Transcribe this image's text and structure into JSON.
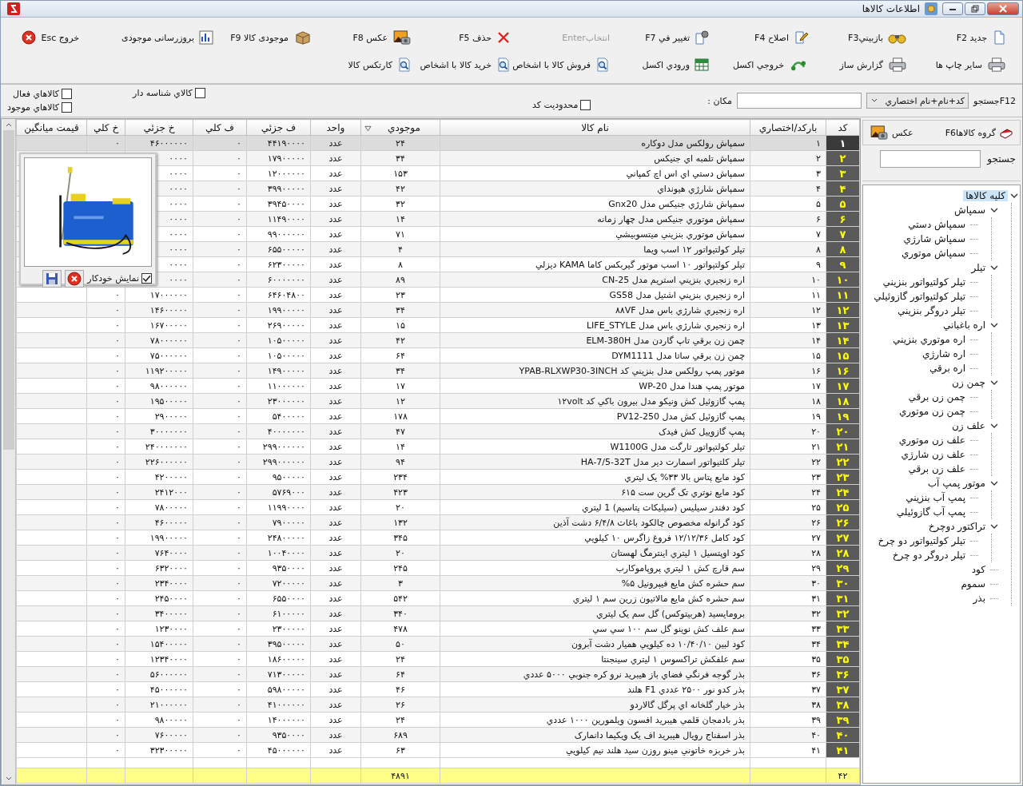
{
  "window": {
    "title": "اطلاعات کالاها"
  },
  "toolbar": {
    "row_1": [
      {
        "label": "جديد F2",
        "disabled": false
      },
      {
        "label": "بازبينيF3",
        "disabled": false
      },
      {
        "label": "اصلاح F4",
        "disabled": false
      },
      {
        "label": "تغيير في F7",
        "disabled": false
      },
      {
        "label": "انتخابEnter",
        "disabled": true
      },
      {
        "label": "حذف F5",
        "disabled": false
      },
      {
        "label": "عکس F8",
        "disabled": false
      },
      {
        "label": "موجودی کالا F9",
        "disabled": false
      },
      {
        "label": "بروزرسانی موجودی",
        "disabled": false
      }
    ],
    "row_2": [
      {
        "label": "ساير چاپ ها",
        "disabled": false
      },
      {
        "label": "گزارش ساز",
        "disabled": false
      },
      {
        "label": "خروجي اکسل",
        "disabled": false
      },
      {
        "label": "ورودي اکسل",
        "disabled": false
      },
      {
        "label": "فروش کالا با اشخاص",
        "disabled": false
      },
      {
        "label": "خريد کالا با اشخاص",
        "disabled": false
      },
      {
        "label": "کارتکس کالا",
        "disabled": false
      }
    ],
    "exit": {
      "label": "خروج  Esc"
    }
  },
  "filter": {
    "search_label": "F12جستجو",
    "search_mode": "کد+نام+نام اختصاري",
    "place_label": "مکان :",
    "checkboxes": [
      {
        "label": "محدوديت کد",
        "checked": false
      },
      {
        "label": "کالاي شناسه دار",
        "checked": false
      },
      {
        "label": "کالاهاي فعال",
        "checked": false
      },
      {
        "label": "کالاهاي موجود",
        "checked": false
      }
    ]
  },
  "table": {
    "columns": [
      {
        "label": "کد",
        "sorted": false
      },
      {
        "label": "بارکد/اختصاري",
        "sorted": false
      },
      {
        "label": "نام کالا",
        "sorted": false
      },
      {
        "label": "موجودي",
        "sorted": true
      },
      {
        "label": "واحد",
        "sorted": false
      },
      {
        "label": "ف جزئي",
        "sorted": false
      },
      {
        "label": "ف کلي",
        "sorted": false
      },
      {
        "label": "خ جزئي",
        "sorted": false
      },
      {
        "label": "خ کلي",
        "sorted": false
      },
      {
        "label": "قيمت ميانگين",
        "sorted": false
      }
    ],
    "rows": [
      {
        "code": "۱",
        "barcode": "۱",
        "name": "سمپاش رولکس مدل دوکاره",
        "stock": "۲۴",
        "unit": "عدد",
        "sale_unit": "۴۴۱۹۰۰۰۰",
        "sale_total": "۰",
        "buy_unit": "۴۶۰۰۰۰۰۰",
        "buy_total": "۰",
        "selected": true
      },
      {
        "code": "۲",
        "barcode": "۲",
        "name": "سمپاش تلمبه اي جنيکس",
        "stock": "۳۴",
        "unit": "عدد",
        "sale_unit": "۱۷۹۰۰۰۰۰",
        "sale_total": "۰",
        "buy_unit": "۰۰۰۰",
        "selected": false
      },
      {
        "code": "۳",
        "barcode": "۳",
        "name": "سمپاش دستي اي اس اچ کمپاني",
        "stock": "۱۵۳",
        "unit": "عدد",
        "sale_unit": "۱۲۰۰۰۰۰۰",
        "sale_total": "۰",
        "buy_unit": "۰۰۰۰",
        "selected": false
      },
      {
        "code": "۴",
        "barcode": "۴",
        "name": "سمپاش شارژي هيونداي",
        "stock": "۴۲",
        "unit": "عدد",
        "sale_unit": "۳۹۹۰۰۰۰۰",
        "sale_total": "۰",
        "buy_unit": "۰۰۰۰",
        "selected": false
      },
      {
        "code": "۵",
        "barcode": "۵",
        "name": "سمپاش شارژي جنيکس مدل Gnx20",
        "stock": "۳۲",
        "unit": "عدد",
        "sale_unit": "۳۹۴۵۰۰۰۰",
        "sale_total": "۰",
        "buy_unit": "۰۰۰۰",
        "selected": false
      },
      {
        "code": "۶",
        "barcode": "۶",
        "name": "سمپاش موتوري جنيکس مدل چهار زمانه",
        "stock": "۱۴",
        "unit": "عدد",
        "sale_unit": "۱۱۴۹۰۰۰۰",
        "sale_total": "۰",
        "buy_unit": "۰۰۰۰",
        "selected": false
      },
      {
        "code": "۷",
        "barcode": "۷",
        "name": "سمپاش موتوري بنزيني ميتسوبيشي",
        "stock": "۷۱",
        "unit": "عدد",
        "sale_unit": "۹۹۰۰۰۰۰۰",
        "sale_total": "۰",
        "buy_unit": "۰۰۰۰",
        "selected": false
      },
      {
        "code": "۸",
        "barcode": "۸",
        "name": "تيلر کولتيواتور ۱۲ اسب ويما",
        "stock": "۴",
        "unit": "عدد",
        "sale_unit": "۶۵۵۰۰۰۰۰",
        "sale_total": "۰",
        "buy_unit": "۰۰۰۰",
        "selected": false
      },
      {
        "code": "۹",
        "barcode": "۹",
        "name": "تيلر کولتيواتور ۱۰ اسب موتور گيربکس کاما KAMA ديزلي",
        "stock": "۸",
        "unit": "عدد",
        "sale_unit": "۶۲۳۰۰۰۰۰",
        "sale_total": "۰",
        "buy_unit": "۰۰۰۰",
        "selected": false
      },
      {
        "code": "۱۰",
        "barcode": "۱۰",
        "name": "اره زنجيري بنزيني استريم مدل CN-25",
        "stock": "۸۹",
        "unit": "عدد",
        "sale_unit": "۶۰۰۰۰۰۰۰",
        "sale_total": "۰",
        "buy_unit": "۰۰۰۰",
        "selected": false
      },
      {
        "code": "۱۱",
        "barcode": "۱۱",
        "name": "اره زنجيري بنزيني اشتيل مدل GS58",
        "stock": "۲۳",
        "unit": "عدد",
        "sale_unit": "۶۴۶۰۴۸۰۰",
        "sale_total": "۰",
        "buy_unit": "۱۷۰۰۰۰۰۰",
        "buy_total": "۰",
        "selected": false
      },
      {
        "code": "۱۲",
        "barcode": "۱۲",
        "name": "اره زنجيري شارژي باس مدل ۸۸VF",
        "stock": "۳۴",
        "unit": "عدد",
        "sale_unit": "۱۹۹۰۰۰۰۰",
        "sale_total": "۰",
        "buy_unit": "۱۴۶۰۰۰۰۰",
        "buy_total": "۰",
        "selected": false
      },
      {
        "code": "۱۳",
        "barcode": "۱۳",
        "name": "اره زنجيري شارژي باس مدل LIFE_STYLE",
        "stock": "۱۵",
        "unit": "عدد",
        "sale_unit": "۲۶۹۰۰۰۰۰",
        "sale_total": "۰",
        "buy_unit": "۱۶۷۰۰۰۰۰",
        "buy_total": "۰",
        "selected": false
      },
      {
        "code": "۱۴",
        "barcode": "۱۴",
        "name": "چمن زن برقي تاپ گاردن مدل ELM-380H",
        "stock": "۴۲",
        "unit": "عدد",
        "sale_unit": "۱۰۵۰۰۰۰۰",
        "sale_total": "۰",
        "buy_unit": "۷۸۰۰۰۰۰۰",
        "buy_total": "۰",
        "selected": false
      },
      {
        "code": "۱۵",
        "barcode": "۱۵",
        "name": "چمن زن برقي ساتا مدل DYM1111",
        "stock": "۶۴",
        "unit": "عدد",
        "sale_unit": "۱۰۵۰۰۰۰۰",
        "sale_total": "۰",
        "buy_unit": "۷۵۰۰۰۰۰۰",
        "buy_total": "۰",
        "selected": false
      },
      {
        "code": "۱۶",
        "barcode": "۱۶",
        "name": "موتور پمپ رولکس مدل بنزيني کد YPAB-RLXWP30-3INCH",
        "stock": "۳۴",
        "unit": "عدد",
        "sale_unit": "۱۴۹۰۰۰۰۰",
        "sale_total": "۰",
        "buy_unit": "۱۱۹۲۰۰۰۰۰",
        "buy_total": "۰",
        "selected": false
      },
      {
        "code": "۱۷",
        "barcode": "۱۷",
        "name": "موتور پمپ هندا مدل WP-20",
        "stock": "۱۷",
        "unit": "عدد",
        "sale_unit": "۱۱۰۰۰۰۰۰",
        "sale_total": "۰",
        "buy_unit": "۹۸۰۰۰۰۰۰",
        "buy_total": "۰",
        "selected": false
      },
      {
        "code": "۱۸",
        "barcode": "۱۸",
        "name": "پمپ گازوئيل کش ونيکو مدل بيرون باکي کد ۱۲volt",
        "stock": "۱۲",
        "unit": "عدد",
        "sale_unit": "۲۳۰۰۰۰۰۰",
        "sale_total": "۰",
        "buy_unit": "۱۹۵۰۰۰۰۰",
        "buy_total": "۰",
        "selected": false
      },
      {
        "code": "۱۹",
        "barcode": "۱۹",
        "name": "پمپ گازوئيل کش مدل PV12-250",
        "stock": "۱۷۸",
        "unit": "عدد",
        "sale_unit": "۵۴۰۰۰۰۰",
        "sale_total": "۰",
        "buy_unit": "۲۹۰۰۰۰۰",
        "buy_total": "۰",
        "selected": false
      },
      {
        "code": "۲۰",
        "barcode": "۲۰",
        "name": "پمپ گازوييل کش فيدک",
        "stock": "۴۷",
        "unit": "عدد",
        "sale_unit": "۴۰۰۰۰۰۰۰",
        "sale_total": "۰",
        "buy_unit": "۳۰۰۰۰۰۰۰",
        "buy_total": "۰",
        "selected": false
      },
      {
        "code": "۲۱",
        "barcode": "۲۱",
        "name": "تيلر کولتيواتور تارگت مدل W1100G",
        "stock": "۱۴",
        "unit": "عدد",
        "sale_unit": "۲۹۹۰۰۰۰۰۰",
        "sale_total": "۰",
        "buy_unit": "۲۴۰۰۰۰۰۰۰",
        "buy_total": "۰",
        "selected": false
      },
      {
        "code": "۲۲",
        "barcode": "۲۲",
        "name": "تيلر کلتيواتور اسمارت دير مدل HA-7/5-32T",
        "stock": "۹۴",
        "unit": "عدد",
        "sale_unit": "۲۹۹۰۰۰۰۰۰",
        "sale_total": "۰",
        "buy_unit": "۲۲۶۰۰۰۰۰۰",
        "buy_total": "۰",
        "selected": false
      },
      {
        "code": "۲۳",
        "barcode": "۲۳",
        "name": "کود مايع پتاس بالا ۳۳% يک ليتري",
        "stock": "۲۳۴",
        "unit": "عدد",
        "sale_unit": "۹۵۰۰۰۰۰",
        "sale_total": "۰",
        "buy_unit": "۴۲۰۰۰۰۰",
        "buy_total": "۰",
        "selected": false
      },
      {
        "code": "۲۴",
        "barcode": "۲۴",
        "name": "کود مايع نوتري تک گرين ست ۶۱۵",
        "stock": "۴۲۳",
        "unit": "عدد",
        "sale_unit": "۵۷۶۹۰۰۰",
        "sale_total": "۰",
        "buy_unit": "۲۴۱۲۰۰۰",
        "buy_total": "۰",
        "selected": false
      },
      {
        "code": "۲۵",
        "barcode": "۲۵",
        "name": "کود دفندر سيليس (سيليکات پتاسيم) 1 ليتري",
        "stock": "۲۰",
        "unit": "عدد",
        "sale_unit": "۱۱۹۹۰۰۰۰",
        "sale_total": "۰",
        "buy_unit": "۷۸۰۰۰۰۰",
        "buy_total": "۰",
        "selected": false
      },
      {
        "code": "۲۶",
        "barcode": "۲۶",
        "name": "کود گرانوله مخصوص چالکود باغات ۶/۴/۸ دشت آذين",
        "stock": "۱۳۲",
        "unit": "عدد",
        "sale_unit": "۷۹۰۰۰۰۰",
        "sale_total": "۰",
        "buy_unit": "۴۶۰۰۰۰۰",
        "buy_total": "۰",
        "selected": false
      },
      {
        "code": "۲۷",
        "barcode": "۲۷",
        "name": "کود کامل ۱۲/۱۲/۳۶ فروغ زاگرس ۱۰ کيلويي",
        "stock": "۳۴۵",
        "unit": "عدد",
        "sale_unit": "۲۴۸۰۰۰۰۰",
        "sale_total": "۰",
        "buy_unit": "۱۹۹۰۰۰۰۰",
        "buy_total": "۰",
        "selected": false
      },
      {
        "code": "۲۸",
        "barcode": "۲۸",
        "name": "کود اوپتسيل ۱ ليتري اينترمگ لهستان",
        "stock": "۲۰",
        "unit": "عدد",
        "sale_unit": "۱۰۰۴۰۰۰۰",
        "sale_total": "۰",
        "buy_unit": "۷۶۴۰۰۰۰",
        "buy_total": "۰",
        "selected": false
      },
      {
        "code": "۲۹",
        "barcode": "۲۹",
        "name": "سم قارچ کش ۱ ليتري پروپاموکارب",
        "stock": "۲۴۵",
        "unit": "عدد",
        "sale_unit": "۹۳۵۰۰۰۰",
        "sale_total": "۰",
        "buy_unit": "۶۳۲۰۰۰۰",
        "buy_total": "۰",
        "selected": false
      },
      {
        "code": "۳۰",
        "barcode": "۳۰",
        "name": "سم حشره کش مايع فيپرونيل ۵%",
        "stock": "۳",
        "unit": "عدد",
        "sale_unit": "۷۲۰۰۰۰۰",
        "sale_total": "۰",
        "buy_unit": "۲۳۴۰۰۰۰",
        "buy_total": "۰",
        "selected": false
      },
      {
        "code": "۳۱",
        "barcode": "۳۱",
        "name": "سم حشره کش مايع مالاتيون زرين سم ۱ ليتري",
        "stock": "۵۴۲",
        "unit": "عدد",
        "sale_unit": "۶۵۵۰۰۰۰",
        "sale_total": "۰",
        "buy_unit": "۲۴۵۰۰۰۰",
        "buy_total": "۰",
        "selected": false
      },
      {
        "code": "۳۲",
        "barcode": "۳۲",
        "name": "برومايسيد (هربيتوکس) گل سم يک ليتري",
        "stock": "۳۴۰",
        "unit": "عدد",
        "sale_unit": "۶۱۰۰۰۰۰",
        "sale_total": "۰",
        "buy_unit": "۳۴۰۰۰۰۰",
        "buy_total": "۰",
        "selected": false
      },
      {
        "code": "۳۳",
        "barcode": "۳۳",
        "name": "سم علف کش نوينو گل سم ۱۰۰ سي سي",
        "stock": "۴۷۸",
        "unit": "عدد",
        "sale_unit": "۲۳۰۰۰۰۰",
        "sale_total": "۰",
        "buy_unit": "۱۲۳۰۰۰۰",
        "buy_total": "۰",
        "selected": false
      },
      {
        "code": "۳۴",
        "barcode": "۳۴",
        "name": "کود لبين ۱۰/۴۰/۱۰ ده کيلويي هميار دشت آبرون",
        "stock": "۵۰",
        "unit": "عدد",
        "sale_unit": "۳۹۵۰۰۰۰۰",
        "sale_total": "۰",
        "buy_unit": "۱۵۴۰۰۰۰۰",
        "buy_total": "۰",
        "selected": false
      },
      {
        "code": "۳۵",
        "barcode": "۳۵",
        "name": "سم علفکش تراکسوس ۱ ليتري سينجنتا",
        "stock": "۲۴",
        "unit": "عدد",
        "sale_unit": "۱۸۶۰۰۰۰۰",
        "sale_total": "۰",
        "buy_unit": "۱۲۳۴۰۰۰۰",
        "buy_total": "۰",
        "selected": false
      },
      {
        "code": "۳۶",
        "barcode": "۳۶",
        "name": "بذر گوجه فرنگي فضاي باز هيبريد نرو کره جنوبي ۵۰۰۰ عددي",
        "stock": "۶۴",
        "unit": "عدد",
        "sale_unit": "۷۱۳۰۰۰۰۰",
        "sale_total": "۰",
        "buy_unit": "۵۶۰۰۰۰۰۰",
        "buy_total": "۰",
        "selected": false
      },
      {
        "code": "۳۷",
        "barcode": "۳۷",
        "name": "بذر کدو نور ۲۵۰۰ عددي F1 هلند",
        "stock": "۴۶",
        "unit": "عدد",
        "sale_unit": "۵۹۸۰۰۰۰۰",
        "sale_total": "۰",
        "buy_unit": "۴۵۰۰۰۰۰۰",
        "buy_total": "۰",
        "selected": false
      },
      {
        "code": "۳۸",
        "barcode": "۳۸",
        "name": "بذر خيار گلخانه اي پرگل گالاردو",
        "stock": "۲۶",
        "unit": "عدد",
        "sale_unit": "۴۱۰۰۰۰۰۰",
        "sale_total": "۰",
        "buy_unit": "۲۱۰۰۰۰۰۰",
        "buy_total": "۰",
        "selected": false
      },
      {
        "code": "۳۹",
        "barcode": "۳۹",
        "name": "بذر بادمجان قلمي هيبريد افسون ويلمورين ۱۰۰۰ عددي",
        "stock": "۲۴",
        "unit": "عدد",
        "sale_unit": "۱۴۰۰۰۰۰۰",
        "sale_total": "۰",
        "buy_unit": "۹۸۰۰۰۰۰",
        "buy_total": "۰",
        "selected": false
      },
      {
        "code": "۴۰",
        "barcode": "۴۰",
        "name": "بذر اسفناج رويال هيبريد اف يک ويکيما دانمارک",
        "stock": "۶۸۹",
        "unit": "عدد",
        "sale_unit": "۹۳۵۰۰۰۰",
        "sale_total": "۰",
        "buy_unit": "۷۶۰۰۰۰۰",
        "buy_total": "۰",
        "selected": false
      },
      {
        "code": "۴۱",
        "barcode": "۴۱",
        "name": "بذر خربزه خاتوني مينو روزن سيد هلند نيم کيلويي",
        "stock": "۶۳",
        "unit": "عدد",
        "sale_unit": "۴۵۰۰۰۰۰۰",
        "sale_total": "۰",
        "buy_unit": "۳۲۳۰۰۰۰۰",
        "buy_total": "۰",
        "selected": false
      }
    ],
    "footer": {
      "count": "۴۲",
      "stock_total": "۴۸۹۱"
    }
  },
  "image_popup": {
    "auto_show": {
      "label": "نمايش خودکار",
      "checked": true
    }
  },
  "sidebar": {
    "groups_button": "گروه کالاهاF6",
    "photo_button": "عکس",
    "search_label": "جستجو",
    "tree": {
      "label": "کليه کالاها",
      "selected": true,
      "expanded": true,
      "children": [
        {
          "label": "سمپاش",
          "selected": false,
          "expanded": true,
          "children": [
            {
              "label": "سمپاش دستي",
              "selected": false
            },
            {
              "label": "سمپاش شارژي",
              "selected": false
            },
            {
              "label": "سمپاش موتوري",
              "selected": false
            }
          ]
        },
        {
          "label": "تيلر",
          "selected": false,
          "expanded": true,
          "children": [
            {
              "label": "تيلر کولتيواتور بنزيني",
              "selected": false
            },
            {
              "label": "تيلر کولتيواتور گازوئيلي",
              "selected": false
            },
            {
              "label": "تيلر دروگر بنزيني",
              "selected": false
            }
          ]
        },
        {
          "label": "اره باغباني",
          "selected": false,
          "expanded": true,
          "children": [
            {
              "label": "اره موتوري بنزيني",
              "selected": false
            },
            {
              "label": "اره شارژي",
              "selected": false
            },
            {
              "label": "اره برقي",
              "selected": false
            }
          ]
        },
        {
          "label": "چمن زن",
          "selected": false,
          "expanded": true,
          "children": [
            {
              "label": "چمن زن برقي",
              "selected": false
            },
            {
              "label": "چمن زن موتوري",
              "selected": false
            }
          ]
        },
        {
          "label": "علف زن",
          "selected": false,
          "expanded": true,
          "children": [
            {
              "label": "علف زن موتوري",
              "selected": false
            },
            {
              "label": "علف زن شارژي",
              "selected": false
            },
            {
              "label": "علف زن برقي",
              "selected": false
            }
          ]
        },
        {
          "label": "موتور پمپ آب",
          "selected": false,
          "expanded": true,
          "children": [
            {
              "label": "پمپ آب بنزيني",
              "selected": false
            },
            {
              "label": "پمپ آب گازوئيلي",
              "selected": false
            }
          ]
        },
        {
          "label": "تراکتور دوچرخ",
          "selected": false,
          "expanded": true,
          "children": [
            {
              "label": "تيلر کولتيواتور دو چرخ",
              "selected": false
            },
            {
              "label": "تيلر دروگر دو چرخ",
              "selected": false
            }
          ]
        },
        {
          "label": "کود",
          "selected": false
        },
        {
          "label": "سموم",
          "selected": false
        },
        {
          "label": "بذر",
          "selected": false
        }
      ]
    }
  }
}
